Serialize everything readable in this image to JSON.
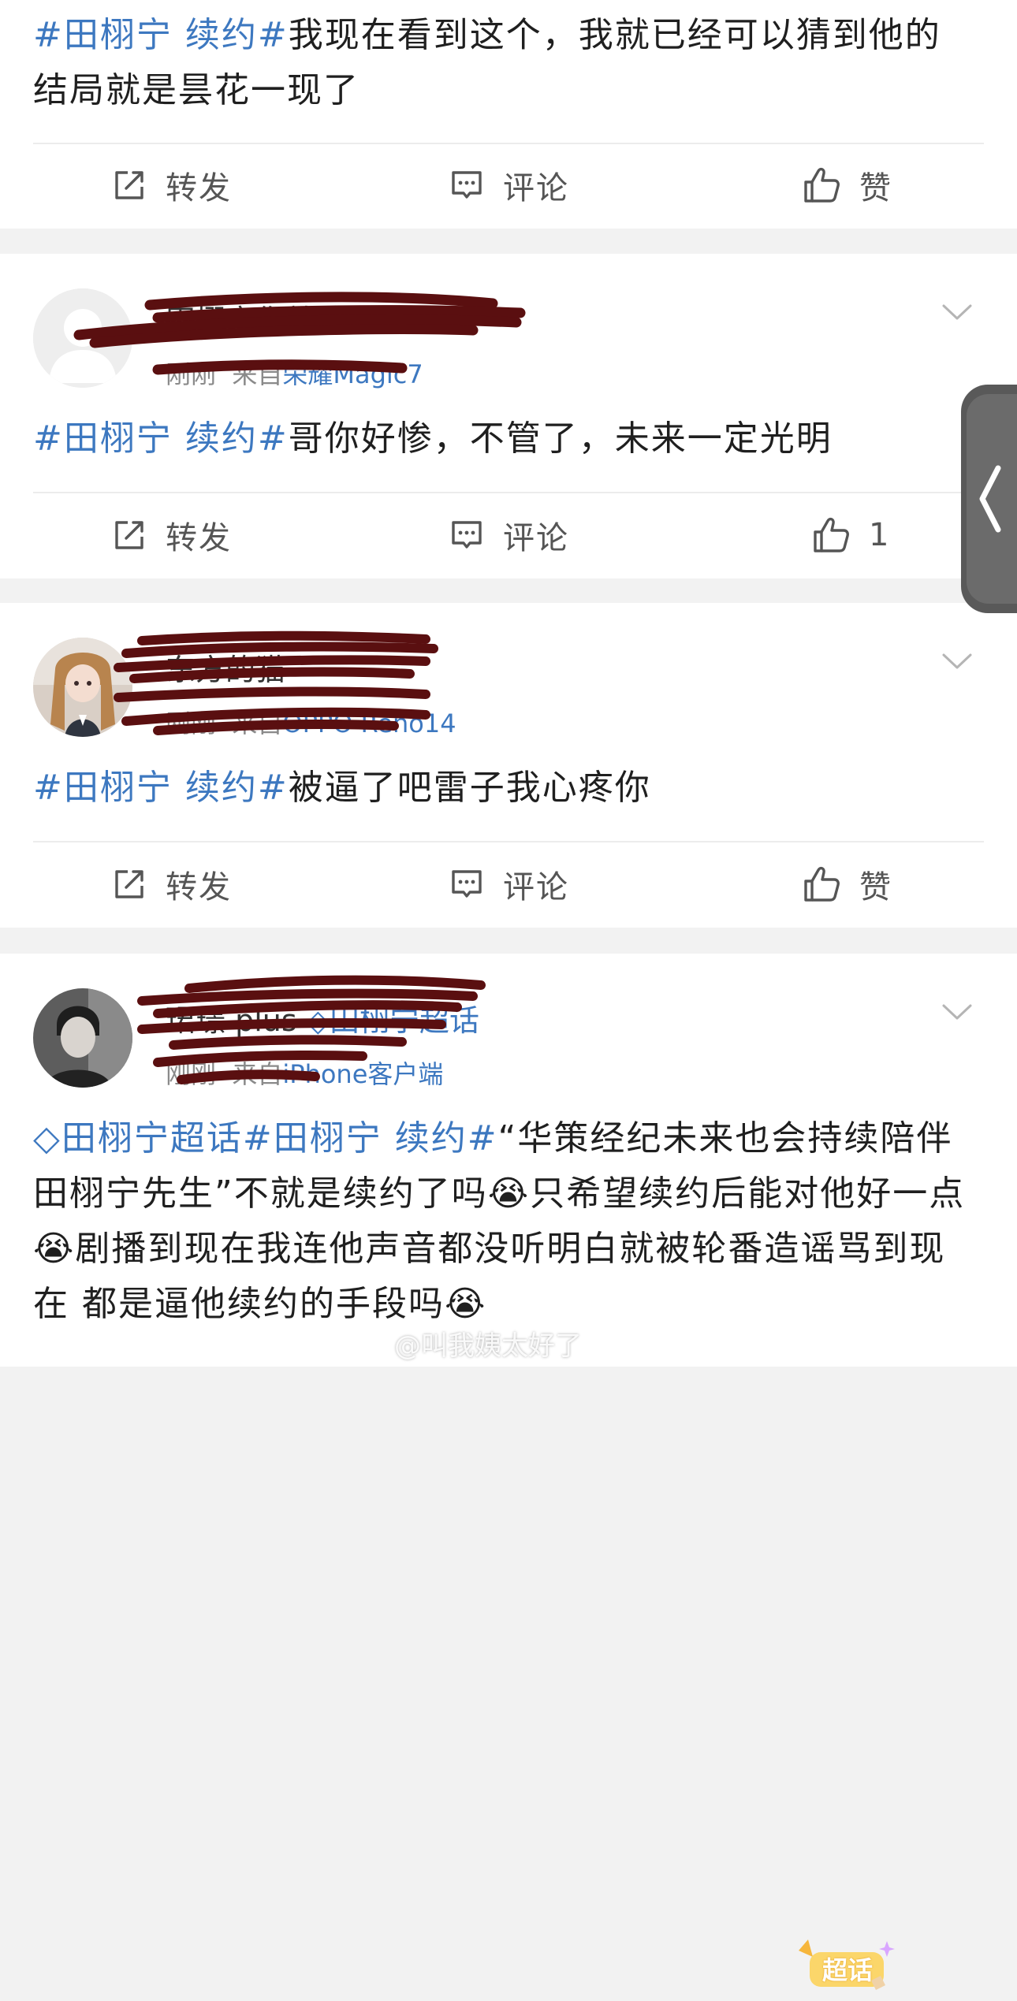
{
  "actions": {
    "repost": "转发",
    "comment": "评论",
    "like": "赞"
  },
  "posts": [
    {
      "topic": "#田栩宁 续约#",
      "text": "我现在看到这个，我就已经可以猜到他的结局就是昙花一现了",
      "like_display": "赞"
    },
    {
      "username": "田栩宁你就是最好的",
      "time": "刚刚",
      "source_prefix": "来自",
      "source": "荣耀Magic7",
      "topic": "#田栩宁 续约#",
      "text": "哥你好惨，不管了，未来一定光明",
      "like_display": "1"
    },
    {
      "username": "东方的猫",
      "time": "刚刚",
      "source_prefix": "来自",
      "source": "OPPO Reno14",
      "topic": "#田栩宁 续约#",
      "text": "被逼了吧雷子我心疼你",
      "like_display": "赞"
    },
    {
      "username": "珺璟 plus",
      "username_topic": "田栩宁超话",
      "time": "刚刚",
      "source_prefix": "来自",
      "source": "iPhone客户端",
      "badge": "超话",
      "supertopic": "田栩宁超话",
      "topic": "#田栩宁 续约#",
      "text": "“华策经纪未来也会持续陪伴田栩宁先生”不就是续约了吗😭只希望续约后能对他好一点😭剧播到现在我连他声音都没听明白就被轮番造谣骂到现在 都是逼他续约的手段吗😭"
    }
  ],
  "watermark": "@叫我姨太好了",
  "colors": {
    "topic": "#3d78c0",
    "divider": "#ececec",
    "background": "#f2f2f2"
  },
  "icons": [
    "repost-icon",
    "comment-icon",
    "like-icon",
    "chevron-down-icon",
    "chevron-left-icon",
    "supertopic-diamond-icon"
  ]
}
